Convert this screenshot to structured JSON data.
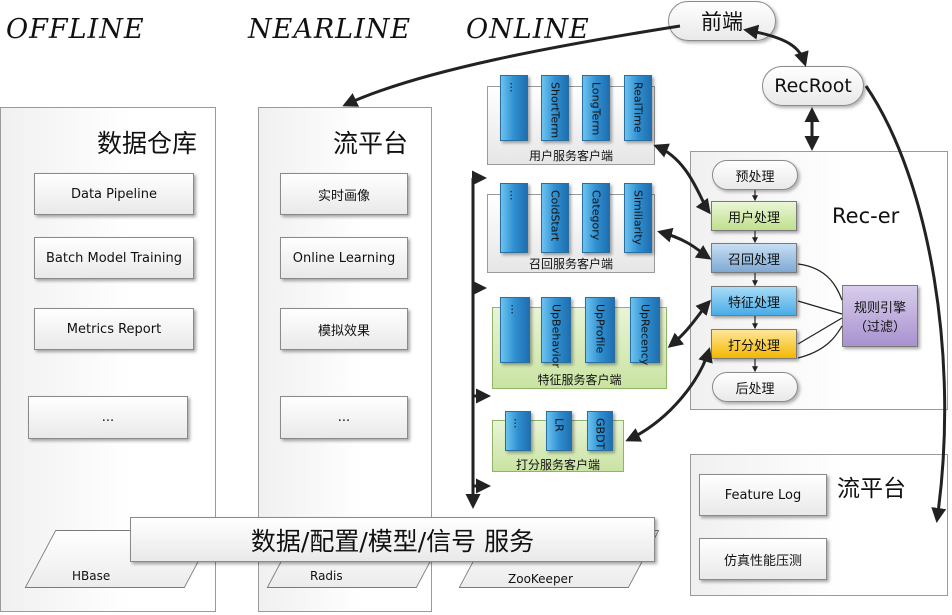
{
  "sections": {
    "offline": "OFFLINE",
    "nearline": "NEARLINE",
    "online": "ONLINE"
  },
  "frontend": "前端",
  "recroot": "RecRoot",
  "warehouse": {
    "title": "数据仓库",
    "items": [
      "Data Pipeline",
      "Batch Model Training",
      "Metrics Report",
      "..."
    ]
  },
  "stream": {
    "title": "流平台",
    "items": [
      "实时画像",
      "Online Learning",
      "模拟效果",
      "..."
    ]
  },
  "clients": [
    {
      "label": "用户服务客户端",
      "services": [
        "...",
        "ShortTerm",
        "LongTerm",
        "RealTime"
      ]
    },
    {
      "label": "召回服务客户端",
      "services": [
        "...",
        "ColdStart",
        "Category",
        "Similiarity"
      ]
    },
    {
      "label": "特征服务客户端",
      "services": [
        "...",
        "UpBehavior",
        "UpProfile",
        "UpRecency"
      ]
    },
    {
      "label": "打分服务客户端",
      "services": [
        "...",
        "LR",
        "GBDT"
      ]
    }
  ],
  "recer": {
    "title": "Rec-er",
    "pre": "预处理",
    "user": "用户处理",
    "recall": "召回处理",
    "feature": "特征处理",
    "score": "打分处理",
    "post": "后处理",
    "rule_engine_line1": "规则引擎",
    "rule_engine_line2": "（过滤）"
  },
  "stream2": {
    "title": "流平台",
    "items": [
      "Feature Log",
      "仿真性能压测"
    ]
  },
  "data_service": "数据/配置/模型/信号 服务",
  "storage": [
    "HBase",
    "Radis",
    "ZooKeeper"
  ]
}
